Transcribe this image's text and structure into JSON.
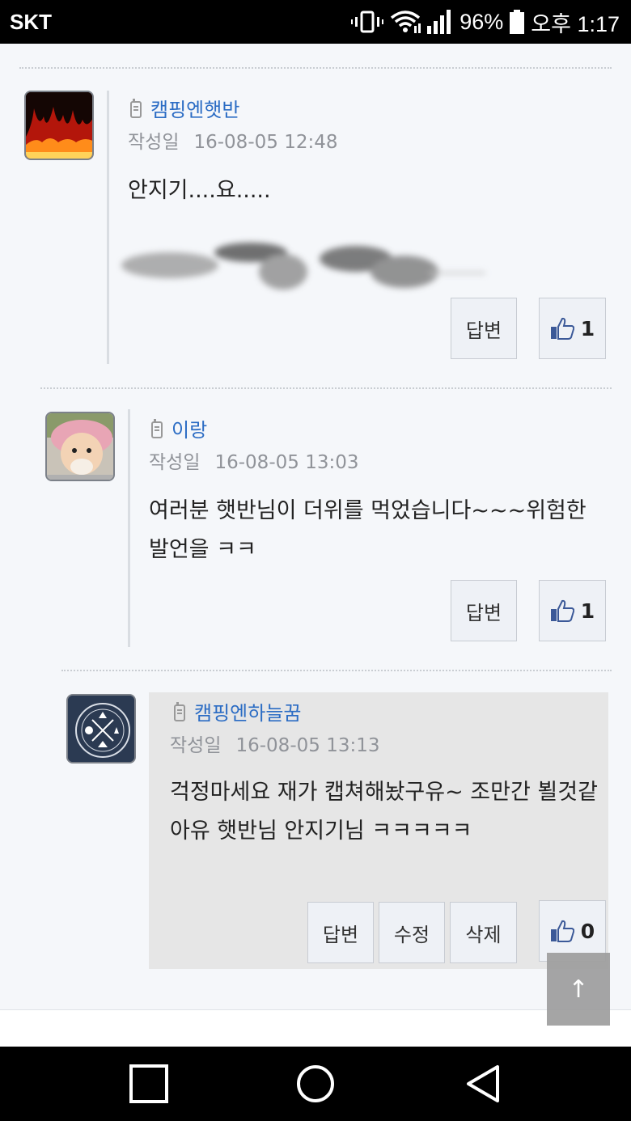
{
  "status_bar": {
    "carrier": "SKT",
    "battery": "96%",
    "time": "오후 1:17",
    "icons": [
      "vibrate-icon",
      "wifi-icon",
      "signal-icon",
      "battery-icon"
    ]
  },
  "comments": [
    {
      "author": "캠핑엔햇반",
      "date_label": "작성일",
      "date": "16-08-05 12:48",
      "text": "안지기....요.....",
      "reply_label": "답변",
      "likes": "1"
    },
    {
      "author": "이랑",
      "date_label": "작성일",
      "date": "16-08-05 13:03",
      "text": "여러분 햇반님이 더위를 먹었습니다~~~위험한 발언을 ㅋㅋ",
      "reply_label": "답변",
      "likes": "1"
    },
    {
      "author": "캠핑엔하늘꿈",
      "date_label": "작성일",
      "date": "16-08-05 13:13",
      "text": "걱정마세요 재가 캡쳐해놨구유~ 조만간 뵐것같아유 햇반님 안지기님 ㅋㅋㅋㅋㅋ",
      "reply_label": "답변",
      "edit_label": "수정",
      "delete_label": "삭제",
      "likes": "0"
    }
  ],
  "scroll_top_label": "↑",
  "colors": {
    "author": "#2b6cc4",
    "like_icon": "#3b5998",
    "reply_highlight": "#e6e6e6"
  }
}
